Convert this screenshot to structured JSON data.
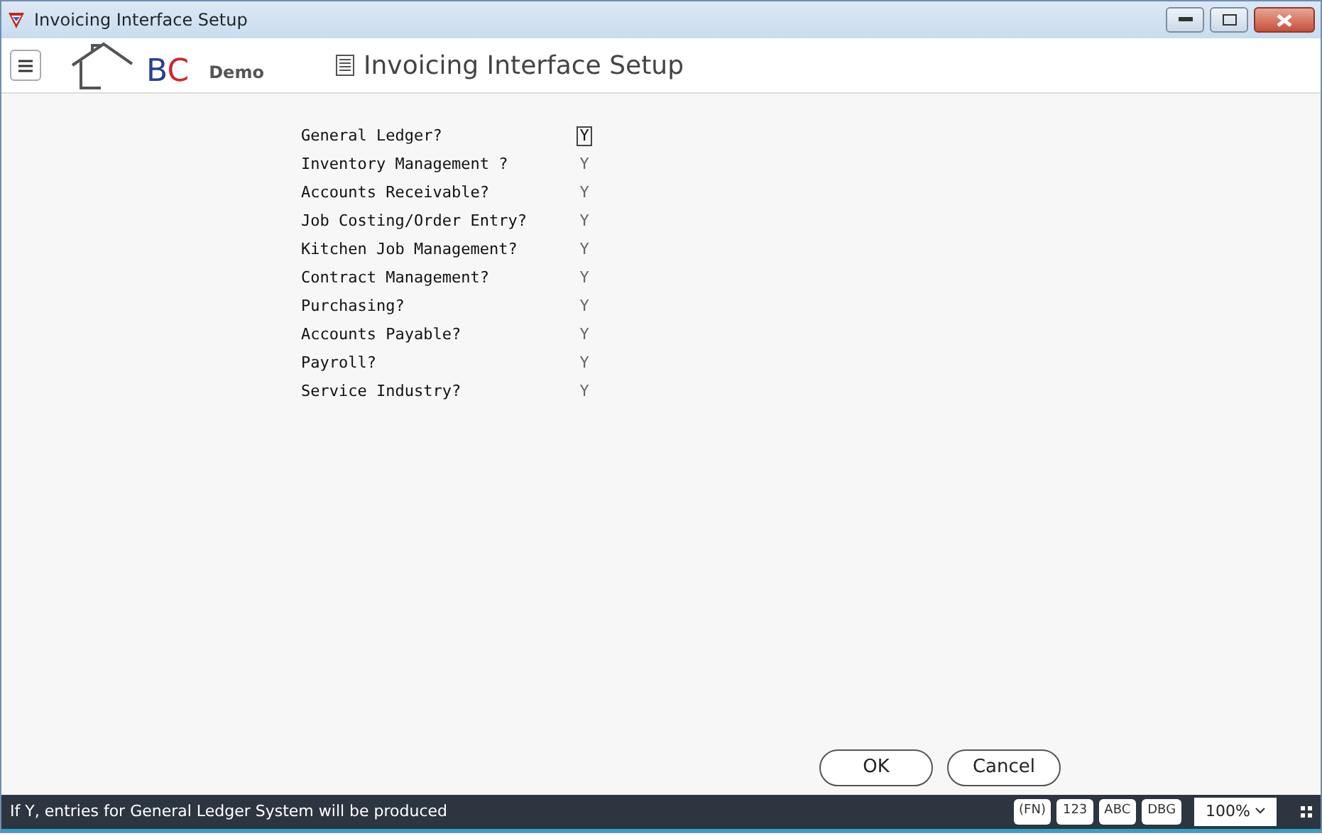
{
  "window": {
    "title": "Invoicing Interface Setup"
  },
  "header": {
    "logo_text": "BC",
    "logo_subtitle": "Demo",
    "page_title": "Invoicing Interface Setup"
  },
  "fields": [
    {
      "label": "General Ledger?",
      "value": "Y",
      "focused": true
    },
    {
      "label": "Inventory Management ?",
      "value": "Y",
      "focused": false
    },
    {
      "label": "Accounts Receivable?",
      "value": "Y",
      "focused": false
    },
    {
      "label": "Job Costing/Order Entry?",
      "value": "Y",
      "focused": false
    },
    {
      "label": "Kitchen Job Management?",
      "value": "Y",
      "focused": false
    },
    {
      "label": "Contract Management?",
      "value": "Y",
      "focused": false
    },
    {
      "label": "Purchasing?",
      "value": "Y",
      "focused": false
    },
    {
      "label": "Accounts Payable?",
      "value": "Y",
      "focused": false
    },
    {
      "label": "Payroll?",
      "value": "Y",
      "focused": false
    },
    {
      "label": "Service Industry?",
      "value": "Y",
      "focused": false
    }
  ],
  "buttons": [
    "OK",
    "Cancel"
  ],
  "status_bar": {
    "message": "If Y, entries for General Ledger System will be produced",
    "keys": [
      "(FN)",
      "123",
      "ABC",
      "DBG"
    ],
    "zoom": "100%"
  }
}
